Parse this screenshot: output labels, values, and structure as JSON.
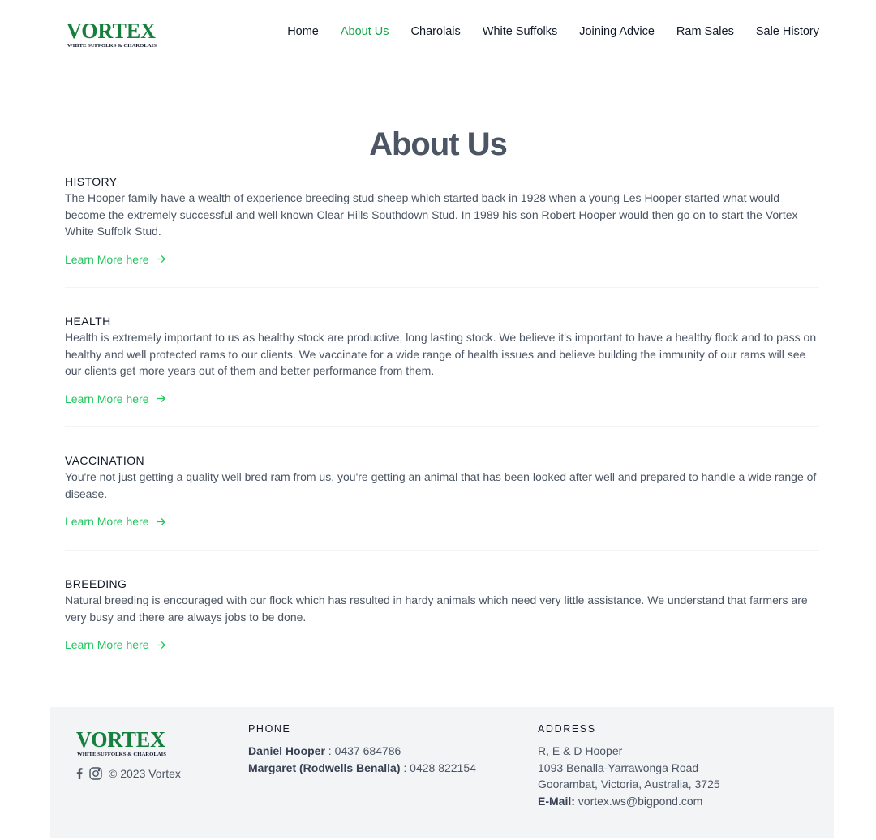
{
  "brand": {
    "logo_text": "VORTEX",
    "logo_tagline": "WHITE SUFFOLKS & CHAROLAIS",
    "accent": "#16a34a"
  },
  "nav": {
    "items": [
      {
        "label": "Home"
      },
      {
        "label": "About Us",
        "active": true
      },
      {
        "label": "Charolais"
      },
      {
        "label": "White Suffolks"
      },
      {
        "label": "Joining Advice"
      },
      {
        "label": "Ram Sales"
      },
      {
        "label": "Sale History"
      }
    ]
  },
  "page": {
    "title": "About Us"
  },
  "sections": [
    {
      "heading": "HISTORY",
      "text": "The Hooper family have a wealth of experience breeding stud sheep which started back in 1928 when a young Les Hooper started what would become the extremely successful and well known Clear Hills Southdown Stud. In 1989 his son Robert Hooper would then go on to start the Vortex White Suffolk Stud.",
      "link": "Learn More here",
      "link_icon": "arrow-right-icon"
    },
    {
      "heading": "HEALTH",
      "text": "Health is extremely important to us as healthy stock are productive, long lasting stock. We believe it's important to have a healthy flock and to pass on healthy and well protected rams to our clients. We vaccinate for a wide range of health issues and believe building the immunity of our rams will see our clients get more years out of them and better performance from them.",
      "link": "Learn More here",
      "link_icon": "arrow-right-icon"
    },
    {
      "heading": "VACCINATION",
      "text": "You're not just getting a quality well bred ram from us, you're getting an animal that has been looked after well and prepared to handle a wide range of disease.",
      "link": "Learn More here",
      "link_icon": "arrow-right-icon"
    },
    {
      "heading": "BREEDING",
      "text": "Natural breeding is encouraged with our flock which has resulted in hardy animals which need very little assistance. We understand that farmers are very busy and there are always jobs to be done.",
      "link": "Learn More here",
      "link_icon": "arrow-right-icon"
    }
  ],
  "footer": {
    "copyright": "© 2023 Vortex",
    "social_icons": [
      "facebook-icon",
      "instagram-icon"
    ],
    "phone": {
      "title": "PHONE",
      "contacts": [
        {
          "name": "Daniel Hooper",
          "number": " : 0437 684786"
        },
        {
          "name": "Margaret (Rodwells Benalla)",
          "number": " : 0428 822154"
        }
      ]
    },
    "address": {
      "title": "ADDRESS",
      "lines": [
        "R, E & D Hooper",
        "1093 Benalla-Yarrawonga Road",
        "Goorambat, Victoria, Australia, 3725"
      ],
      "email_label": "E-Mail:",
      "email": "vortex.ws@bigpond.com"
    }
  }
}
